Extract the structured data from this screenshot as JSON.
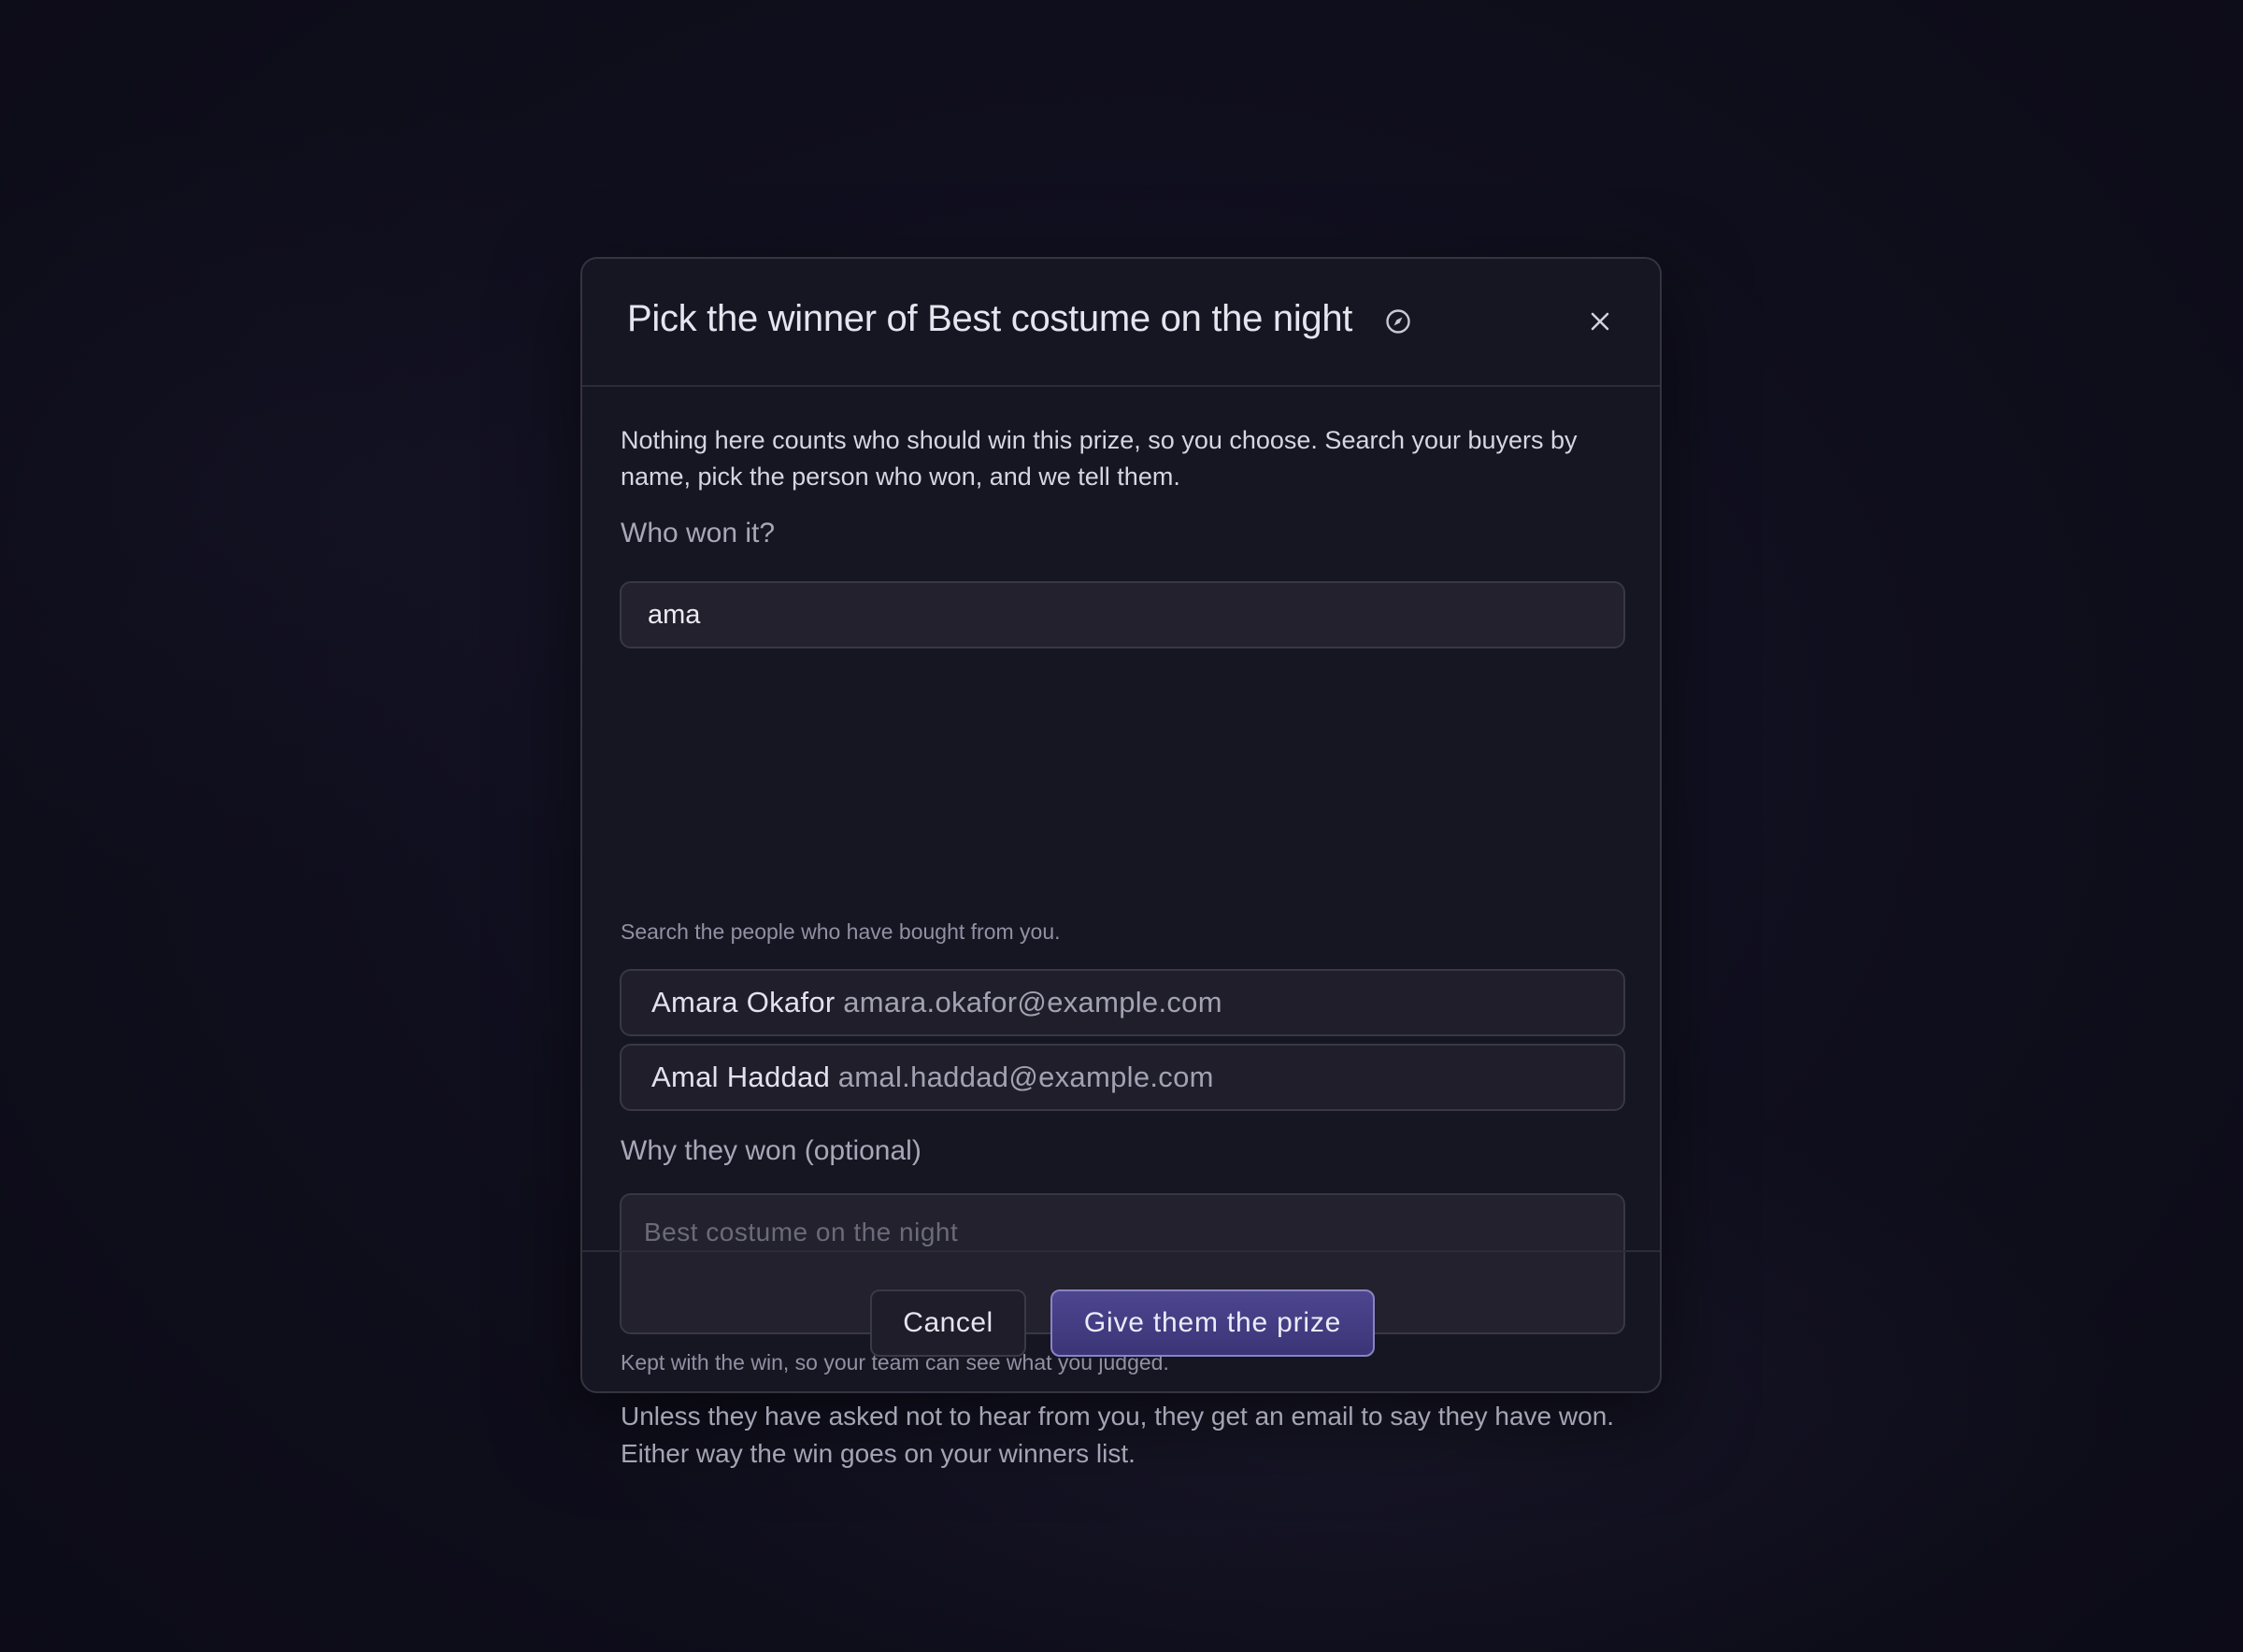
{
  "dialog": {
    "title": "Pick the winner of Best costume on the night",
    "title_icon": "compass-icon",
    "close_icon": "close-icon",
    "intro": "Nothing here counts who should win this prize, so you choose. Search your buyers by name, pick the person who won, and we tell them.",
    "winner_label": "Who won it?",
    "search_value": "ama",
    "search_hint": "Search the people who have bought from you.",
    "results": [
      {
        "name": "Amara Okafor",
        "email": "amara.okafor@example.com"
      },
      {
        "name": "Amal Haddad",
        "email": "amal.haddad@example.com"
      }
    ],
    "reason_label": "Why they won (optional)",
    "reason_placeholder": "Best costume on the night",
    "reason_hint": "Kept with the win, so your team can see what you judged.",
    "notice": "Unless they have asked not to hear from you, they get an email to say they have won. Either way the win goes on your winners list.",
    "cancel_label": "Cancel",
    "submit_label": "Give them the prize"
  },
  "colors": {
    "background": "#0f0e1c",
    "panel": "#161522",
    "accent": "#4d4690",
    "accent_border": "#8a84c4"
  }
}
